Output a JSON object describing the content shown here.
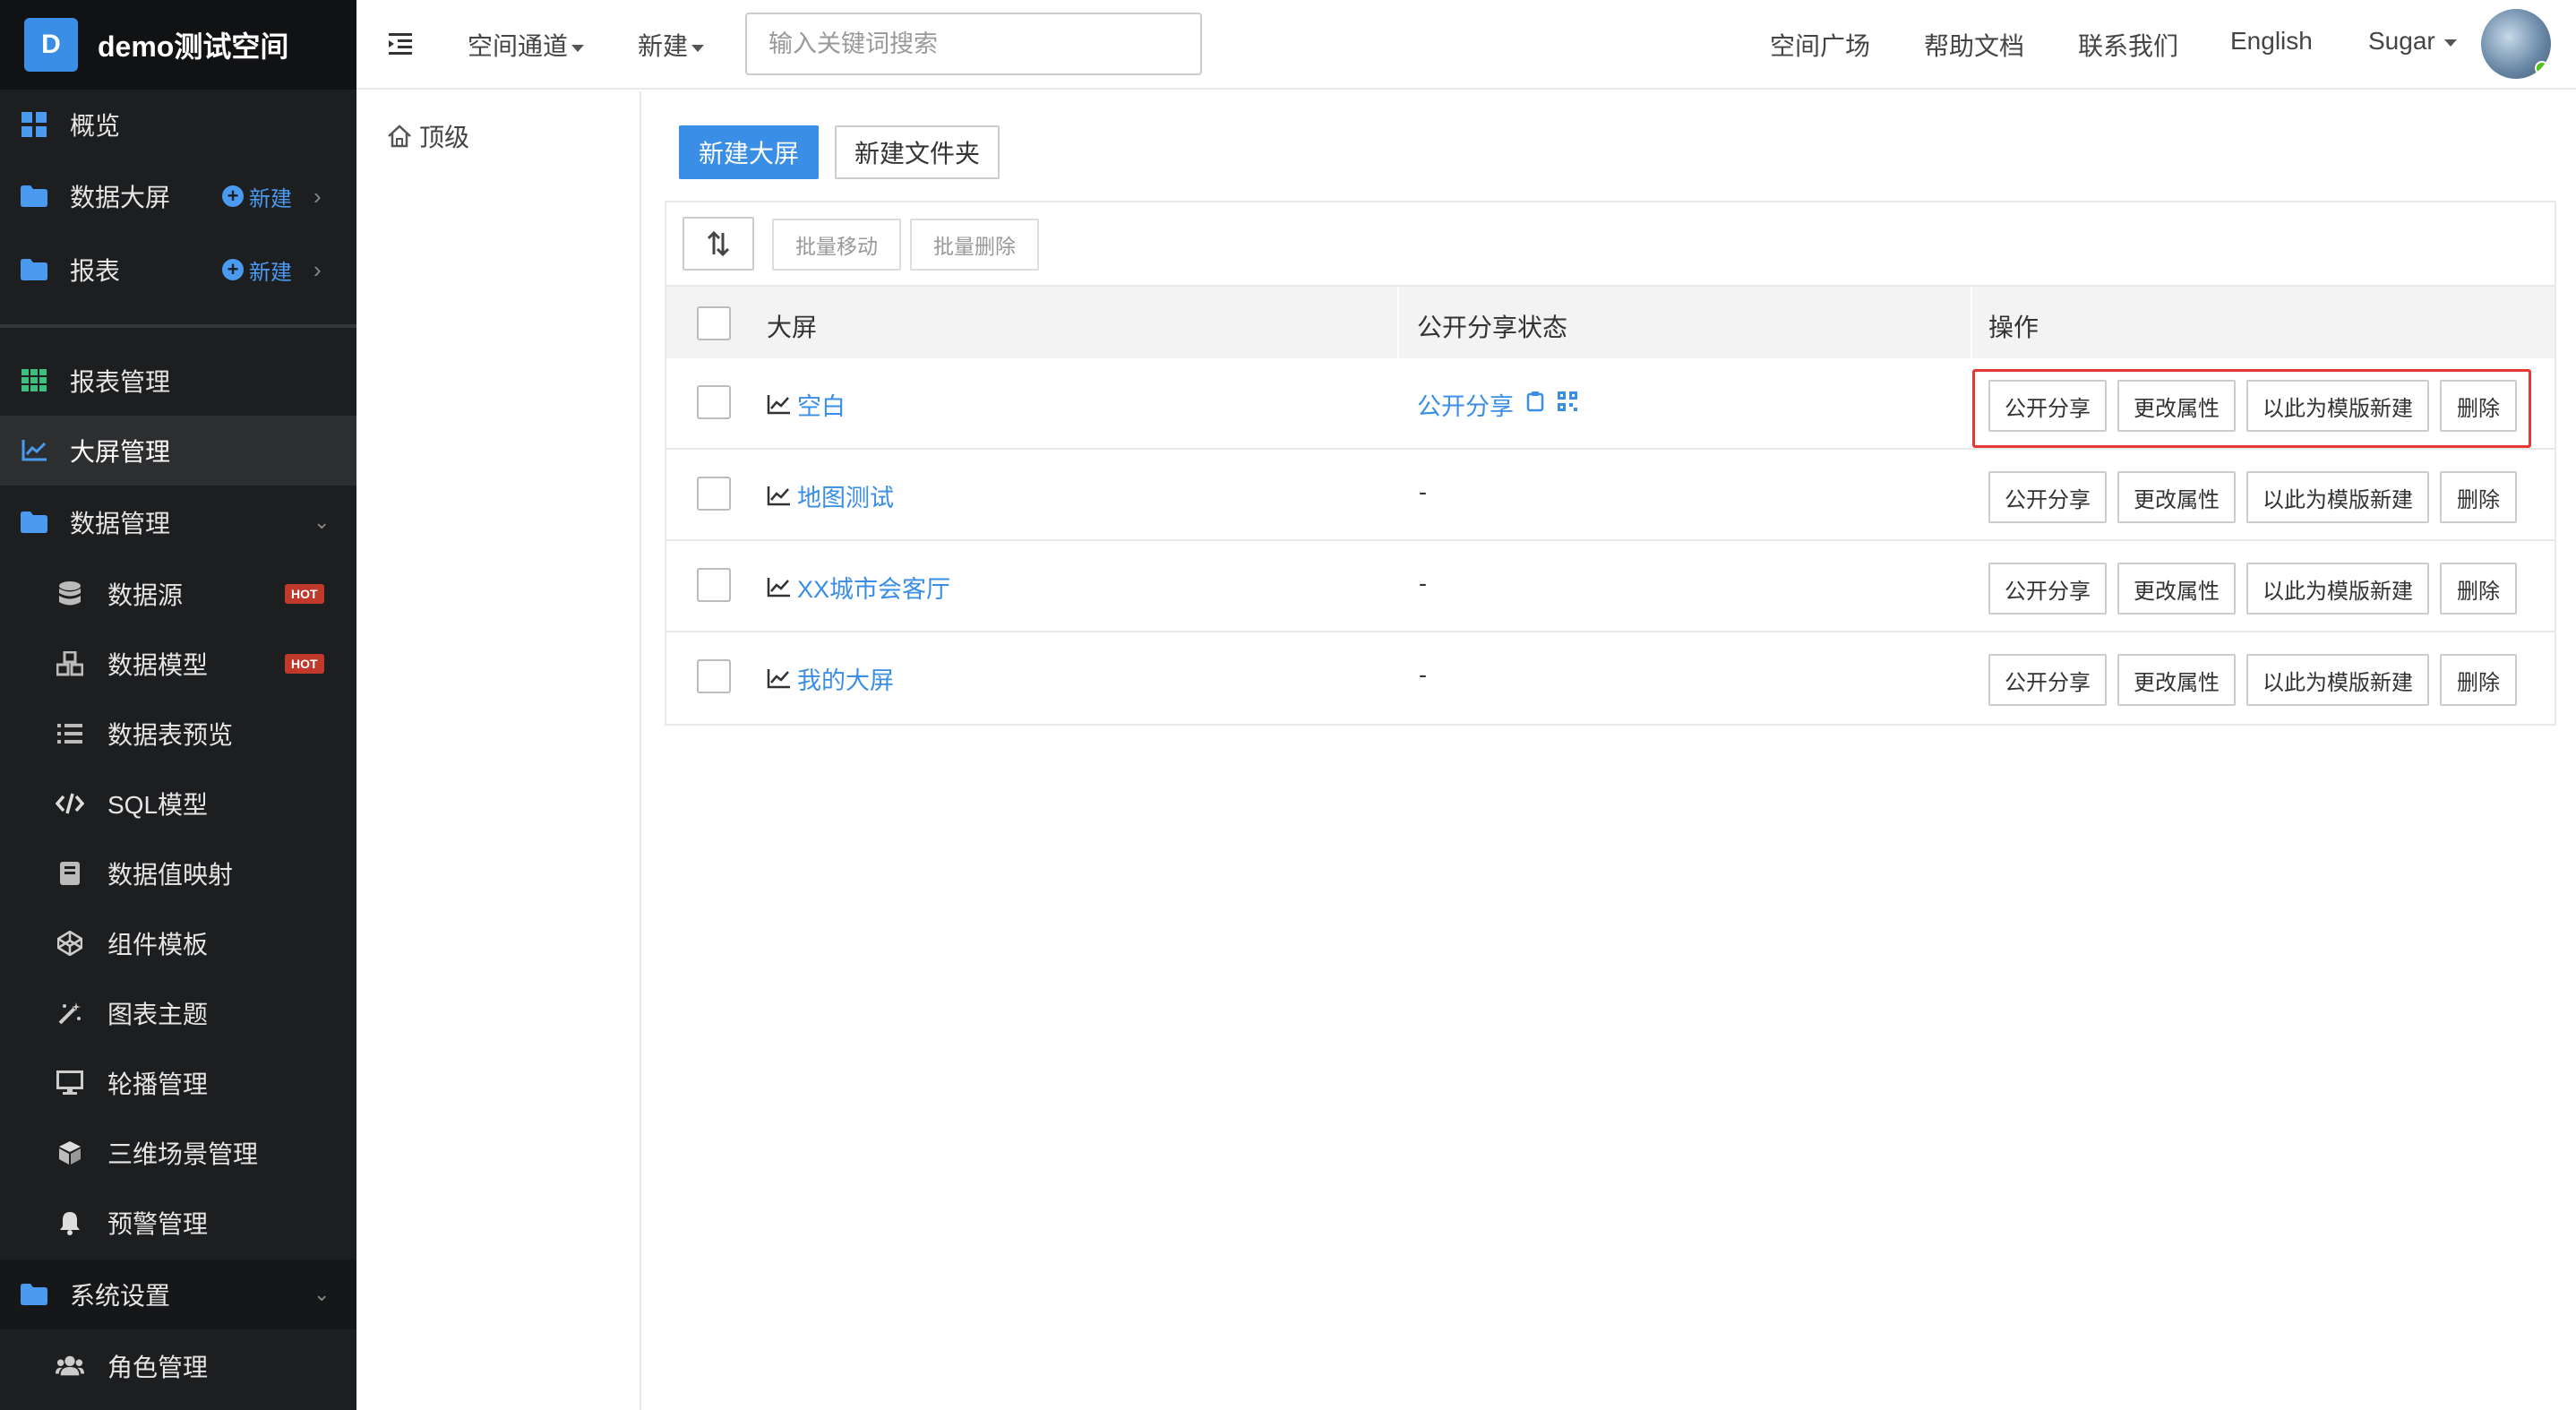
{
  "sidebar": {
    "brand_letter": "D",
    "brand_title": "demo测试空间",
    "items": {
      "overview": "概览",
      "screens": "数据大屏",
      "reports": "报表",
      "report_mgmt": "报表管理",
      "screen_mgmt": "大屏管理",
      "data_mgmt": "数据管理",
      "datasource": "数据源",
      "data_model": "数据模型",
      "table_preview": "数据表预览",
      "sql_model": "SQL模型",
      "value_mapping": "数据值映射",
      "component_tpl": "组件模板",
      "chart_theme": "图表主题",
      "carousel": "轮播管理",
      "scene3d": "三维场景管理",
      "alert": "预警管理",
      "settings": "系统设置",
      "roles": "角色管理"
    },
    "new_label": "新建",
    "hot_badge": "HOT"
  },
  "topbar": {
    "space_channel": "空间通道",
    "new_menu": "新建",
    "search_placeholder": "输入关键词搜索",
    "plaza": "空间广场",
    "help": "帮助文档",
    "contact": "联系我们",
    "language": "English",
    "user": "Sugar"
  },
  "folder": {
    "root": "顶级"
  },
  "main": {
    "new_screen": "新建大屏",
    "new_folder": "新建文件夹",
    "batch_move": "批量移动",
    "batch_delete": "批量删除",
    "columns": {
      "screen": "大屏",
      "share_status": "公开分享状态",
      "actions": "操作"
    },
    "actions": {
      "share": "公开分享",
      "edit": "更改属性",
      "template": "以此为模版新建",
      "delete": "删除"
    },
    "rows": [
      {
        "name": "空白",
        "share": "公开分享"
      },
      {
        "name": "地图测试",
        "share": "-"
      },
      {
        "name": "XX城市会客厅",
        "share": "-"
      },
      {
        "name": "我的大屏",
        "share": "-"
      }
    ]
  },
  "colors": {
    "primary": "#3a8ee6",
    "sidebar_bg": "#1d1e20",
    "highlight": "#e53935",
    "hot": "#c0392b"
  }
}
